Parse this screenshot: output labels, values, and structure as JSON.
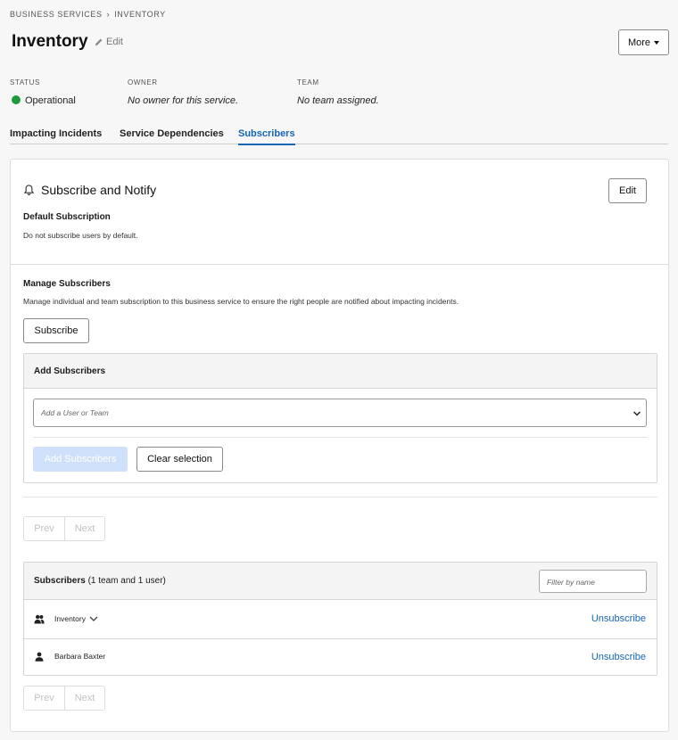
{
  "breadcrumb": {
    "parent": "BUSINESS SERVICES",
    "separator": "›",
    "current": "INVENTORY"
  },
  "header": {
    "title": "Inventory",
    "edit_label": "Edit",
    "more_label": "More"
  },
  "meta": {
    "status_label": "STATUS",
    "status_value": "Operational",
    "status_color": "#1e9a3a",
    "owner_label": "OWNER",
    "owner_value": "No owner for this service.",
    "team_label": "TEAM",
    "team_value": "No team assigned."
  },
  "tabs": [
    {
      "label": "Impacting Incidents",
      "active": false
    },
    {
      "label": "Service Dependencies",
      "active": false
    },
    {
      "label": "Subscribers",
      "active": true
    }
  ],
  "subscribe_section": {
    "title": "Subscribe and Notify",
    "edit_label": "Edit",
    "default_heading": "Default Subscription",
    "default_text": "Do not subscribe users by default."
  },
  "manage_section": {
    "heading": "Manage Subscribers",
    "description": "Manage individual and team subscription to this business service to ensure the right people are notified about impacting incidents.",
    "subscribe_label": "Subscribe"
  },
  "add_panel": {
    "heading": "Add Subscribers",
    "select_placeholder": "Add a User or Team",
    "add_label": "Add Subscribers",
    "clear_label": "Clear selection"
  },
  "pager": {
    "prev": "Prev",
    "next": "Next"
  },
  "subscribers_panel": {
    "heading": "Subscribers",
    "count_text": "(1 team and 1 user)",
    "filter_placeholder": "Filter by name",
    "rows": [
      {
        "name": "Inventory",
        "type": "team",
        "action": "Unsubscribe"
      },
      {
        "name": "Barbara Baxter",
        "type": "user",
        "action": "Unsubscribe"
      }
    ]
  },
  "colors": {
    "accent": "#1565b7",
    "disabled_button": "#cfe0fb"
  }
}
